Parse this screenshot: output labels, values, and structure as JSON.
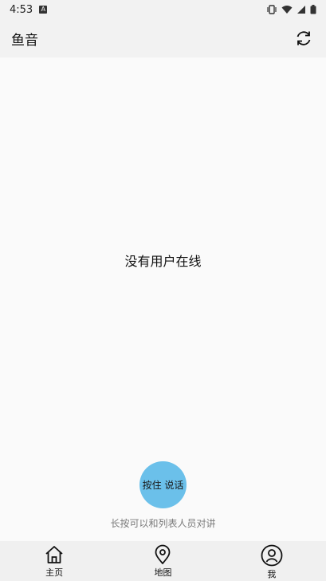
{
  "status_bar": {
    "time": "4:53",
    "notification_letter": "A",
    "icons": [
      "vibrate-icon",
      "wifi-icon",
      "signal-icon",
      "battery-icon"
    ]
  },
  "app_bar": {
    "title": "鱼音",
    "refresh_icon": "refresh-icon"
  },
  "main": {
    "empty_message": "没有用户在线"
  },
  "talk": {
    "button_label": "按住 说话",
    "hint": "长按可以和列表人员对讲",
    "button_color": "#6bc0ea"
  },
  "bottom_nav": {
    "items": [
      {
        "label": "主页",
        "icon": "home-icon"
      },
      {
        "label": "地图",
        "icon": "map-pin-icon"
      },
      {
        "label": "我",
        "icon": "user-icon"
      }
    ]
  }
}
